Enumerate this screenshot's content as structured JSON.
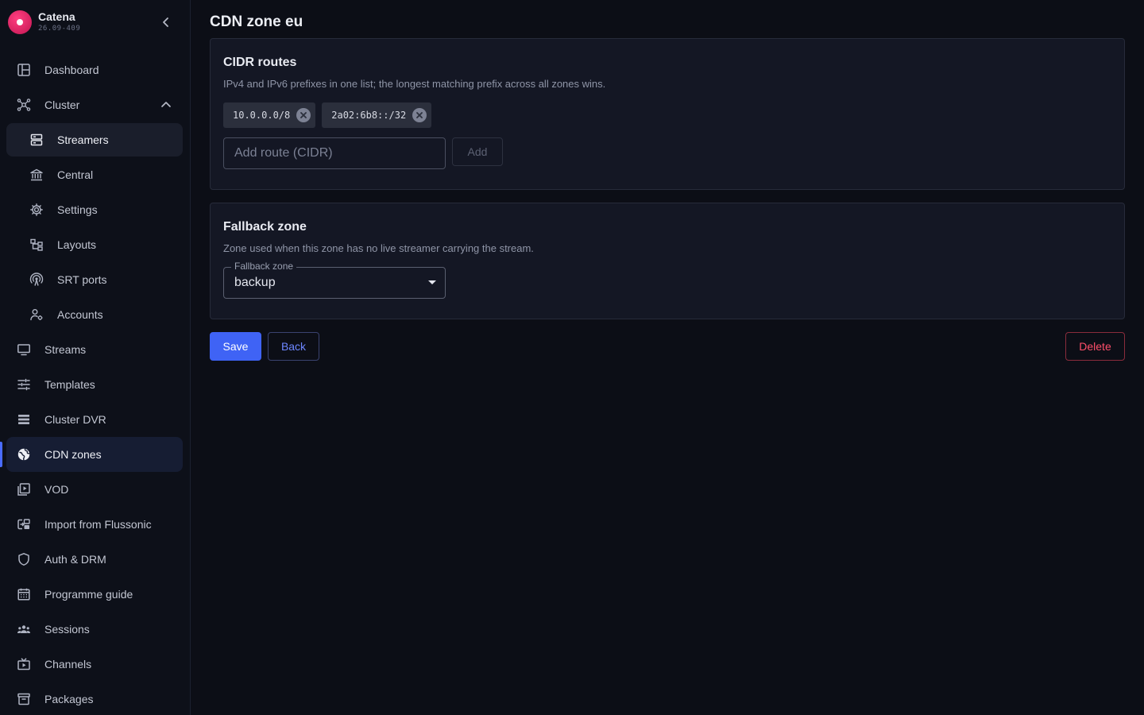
{
  "brand": {
    "name": "Catena",
    "version": "26.09-409"
  },
  "nav": {
    "items": [
      {
        "label": "Dashboard",
        "icon": "dashboard-icon"
      },
      {
        "label": "Cluster",
        "icon": "cluster-icon",
        "expanded": true
      },
      {
        "label": "Streamers",
        "icon": "streamers-icon",
        "sub": true,
        "active": true
      },
      {
        "label": "Central",
        "icon": "central-icon",
        "sub": true
      },
      {
        "label": "Settings",
        "icon": "settings-icon",
        "sub": true
      },
      {
        "label": "Layouts",
        "icon": "layouts-icon",
        "sub": true
      },
      {
        "label": "SRT ports",
        "icon": "srt-ports-icon",
        "sub": true
      },
      {
        "label": "Accounts",
        "icon": "accounts-icon",
        "sub": true
      },
      {
        "label": "Streams",
        "icon": "streams-icon"
      },
      {
        "label": "Templates",
        "icon": "templates-icon"
      },
      {
        "label": "Cluster DVR",
        "icon": "cluster-dvr-icon"
      },
      {
        "label": "CDN zones",
        "icon": "cdn-zones-icon",
        "current": true
      },
      {
        "label": "VOD",
        "icon": "vod-icon"
      },
      {
        "label": "Import from Flussonic",
        "icon": "import-icon"
      },
      {
        "label": "Auth & DRM",
        "icon": "auth-drm-icon"
      },
      {
        "label": "Programme guide",
        "icon": "programme-guide-icon"
      },
      {
        "label": "Sessions",
        "icon": "sessions-icon"
      },
      {
        "label": "Channels",
        "icon": "channels-icon"
      },
      {
        "label": "Packages",
        "icon": "packages-icon"
      }
    ]
  },
  "page": {
    "title": "CDN zone eu"
  },
  "cidr": {
    "title": "CIDR routes",
    "description": "IPv4 and IPv6 prefixes in one list; the longest matching prefix across all zones wins.",
    "routes": [
      "10.0.0.0/8",
      "2a02:6b8::/32"
    ],
    "input_placeholder": "Add route (CIDR)",
    "input_value": "",
    "add_label": "Add"
  },
  "fallback": {
    "title": "Fallback zone",
    "description": "Zone used when this zone has no live streamer carrying the stream.",
    "field_label": "Fallback zone",
    "selected": "backup"
  },
  "actions": {
    "save_label": "Save",
    "back_label": "Back",
    "delete_label": "Delete"
  },
  "colors": {
    "accent": "#3f63f5",
    "danger": "#ff4f6a",
    "brand": "#e0185c",
    "background": "#0c0e16"
  }
}
